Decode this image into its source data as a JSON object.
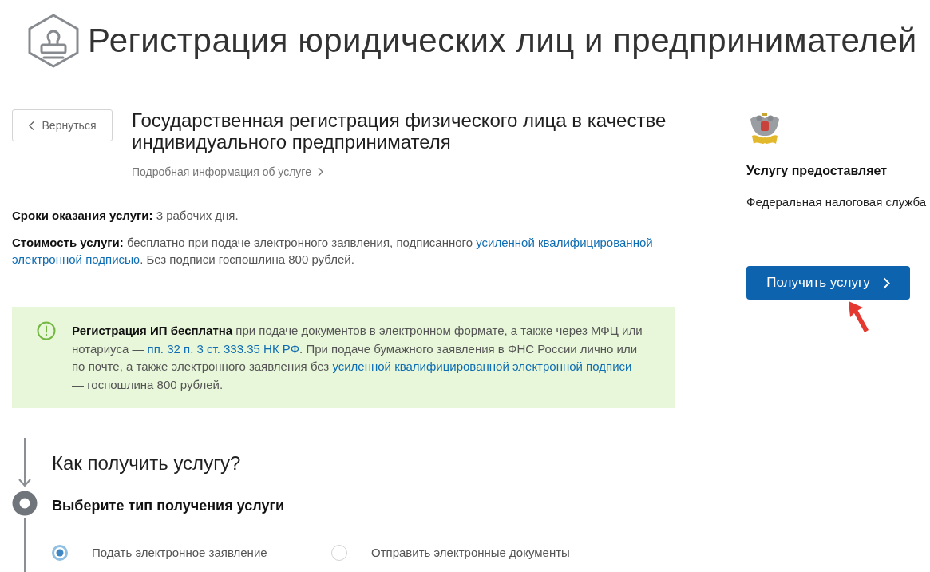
{
  "header": {
    "title": "Регистрация юридических лиц и предпринимателей"
  },
  "back_button": {
    "label": "Вернуться"
  },
  "service": {
    "title": "Государственная регистрация физического лица в качестве индивидуального предпринимателя",
    "details_link": "Подробная информация об услуге"
  },
  "terms": [
    {
      "segments": [
        {
          "kind": "bold",
          "text": "Сроки оказания услуги:"
        },
        {
          "kind": "plain",
          "text": " 3 рабочих дня."
        }
      ]
    },
    {
      "segments": [
        {
          "kind": "bold",
          "text": "Стоимость услуги:"
        },
        {
          "kind": "plain",
          "text": " бесплатно при подаче электронного заявления, подписанного "
        },
        {
          "kind": "link",
          "text": "усиленной квалифицированной"
        },
        {
          "kind": "link",
          "text": "электронной подписью"
        },
        {
          "kind": "plain",
          "text": ". Без подписи госпошлина 800 рублей."
        }
      ]
    }
  ],
  "notice": {
    "segments": [
      {
        "kind": "bold",
        "text": "Регистрация ИП бесплатна"
      },
      {
        "kind": "plain",
        "text": " при подаче документов в электронном формате, а также через МФЦ или нотариуса — "
      },
      {
        "kind": "link",
        "text": "пп. 32 п. 3 ст. 333.35 НК РФ"
      },
      {
        "kind": "plain",
        "text": ". При подаче бумажного заявления в ФНС России лично или по почте, а также электронного заявления без "
      },
      {
        "kind": "link",
        "text": "усиленной квалифицированной электронной подписи"
      },
      {
        "kind": "plain",
        "text": " — госпошлина 800 рублей."
      }
    ]
  },
  "provider": {
    "heading": "Услугу предоставляет",
    "name": "Федеральная налоговая служба"
  },
  "get_service_button": {
    "label": "Получить услугу"
  },
  "how_to": {
    "title": "Как получить услугу?",
    "step_title": "Выберите тип получения услуги",
    "options": [
      {
        "label": "Подать электронное заявление",
        "selected": true
      },
      {
        "label": "Отправить электронные документы",
        "selected": false
      }
    ]
  }
}
